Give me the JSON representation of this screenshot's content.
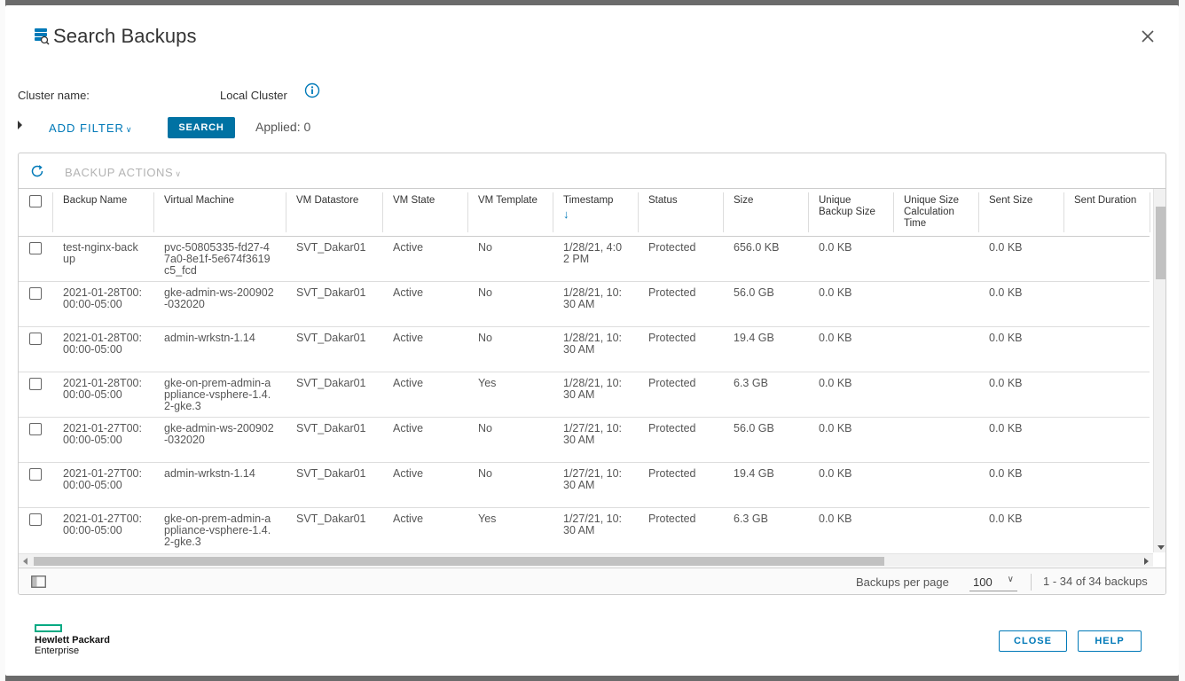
{
  "dialog": {
    "title": "Search Backups",
    "close_icon": "close-x-icon"
  },
  "cluster": {
    "label": "Cluster name:",
    "value": "Local Cluster"
  },
  "filter": {
    "add_filter_label": "ADD FILTER",
    "search_label": "SEARCH",
    "applied": "Applied: 0"
  },
  "actions": {
    "backup_actions_label": "BACKUP ACTIONS"
  },
  "columns": [
    {
      "key": "name",
      "label": "Backup Name"
    },
    {
      "key": "vm",
      "label": "Virtual Machine"
    },
    {
      "key": "datastore",
      "label": "VM Datastore"
    },
    {
      "key": "state",
      "label": "VM State"
    },
    {
      "key": "template",
      "label": "VM Template"
    },
    {
      "key": "timestamp",
      "label": "Timestamp",
      "sorted": "desc"
    },
    {
      "key": "status",
      "label": "Status"
    },
    {
      "key": "size",
      "label": "Size"
    },
    {
      "key": "unique_size",
      "label": "Unique Backup Size"
    },
    {
      "key": "calc_time",
      "label": "Unique Size Calculation Time"
    },
    {
      "key": "sent_size",
      "label": "Sent Size"
    },
    {
      "key": "sent_duration",
      "label": "Sent Duration"
    }
  ],
  "rows": [
    {
      "name": "test-nginx-backup",
      "vm": "pvc-50805335-fd27-47a0-8e1f-5e674f3619c5_fcd",
      "datastore": "SVT_Dakar01",
      "state": "Active",
      "template": "No",
      "timestamp": "1/28/21, 4:02 PM",
      "status": "Protected",
      "size": "656.0 KB",
      "unique_size": "0.0 KB",
      "calc_time": "",
      "sent_size": "0.0 KB",
      "sent_duration": ""
    },
    {
      "name": "2021-01-28T00:00:00-05:00",
      "vm": "gke-admin-ws-200902-032020",
      "datastore": "SVT_Dakar01",
      "state": "Active",
      "template": "No",
      "timestamp": "1/28/21, 10:30 AM",
      "status": "Protected",
      "size": "56.0 GB",
      "unique_size": "0.0 KB",
      "calc_time": "",
      "sent_size": "0.0 KB",
      "sent_duration": ""
    },
    {
      "name": "2021-01-28T00:00:00-05:00",
      "vm": "admin-wrkstn-1.14",
      "datastore": "SVT_Dakar01",
      "state": "Active",
      "template": "No",
      "timestamp": "1/28/21, 10:30 AM",
      "status": "Protected",
      "size": "19.4 GB",
      "unique_size": "0.0 KB",
      "calc_time": "",
      "sent_size": "0.0 KB",
      "sent_duration": ""
    },
    {
      "name": "2021-01-28T00:00:00-05:00",
      "vm": "gke-on-prem-admin-appliance-vsphere-1.4.2-gke.3",
      "datastore": "SVT_Dakar01",
      "state": "Active",
      "template": "Yes",
      "timestamp": "1/28/21, 10:30 AM",
      "status": "Protected",
      "size": "6.3 GB",
      "unique_size": "0.0 KB",
      "calc_time": "",
      "sent_size": "0.0 KB",
      "sent_duration": ""
    },
    {
      "name": "2021-01-27T00:00:00-05:00",
      "vm": "gke-admin-ws-200902-032020",
      "datastore": "SVT_Dakar01",
      "state": "Active",
      "template": "No",
      "timestamp": "1/27/21, 10:30 AM",
      "status": "Protected",
      "size": "56.0 GB",
      "unique_size": "0.0 KB",
      "calc_time": "",
      "sent_size": "0.0 KB",
      "sent_duration": ""
    },
    {
      "name": "2021-01-27T00:00:00-05:00",
      "vm": "admin-wrkstn-1.14",
      "datastore": "SVT_Dakar01",
      "state": "Active",
      "template": "No",
      "timestamp": "1/27/21, 10:30 AM",
      "status": "Protected",
      "size": "19.4 GB",
      "unique_size": "0.0 KB",
      "calc_time": "",
      "sent_size": "0.0 KB",
      "sent_duration": ""
    },
    {
      "name": "2021-01-27T00:00:00-05:00",
      "vm": "gke-on-prem-admin-appliance-vsphere-1.4.2-gke.3",
      "datastore": "SVT_Dakar01",
      "state": "Active",
      "template": "Yes",
      "timestamp": "1/27/21, 10:30 AM",
      "status": "Protected",
      "size": "6.3 GB",
      "unique_size": "0.0 KB",
      "calc_time": "",
      "sent_size": "0.0 KB",
      "sent_duration": ""
    }
  ],
  "pagination": {
    "per_page_label": "Backups per page",
    "per_page_value": "100",
    "count_text": "1 - 34 of 34 backups"
  },
  "brand": {
    "line1": "Hewlett Packard",
    "line2": "Enterprise",
    "accent": "#01a982"
  },
  "buttons": {
    "close": "CLOSE",
    "help": "HELP"
  },
  "colors": {
    "primary": "#0072a3",
    "link": "#0079b8"
  }
}
